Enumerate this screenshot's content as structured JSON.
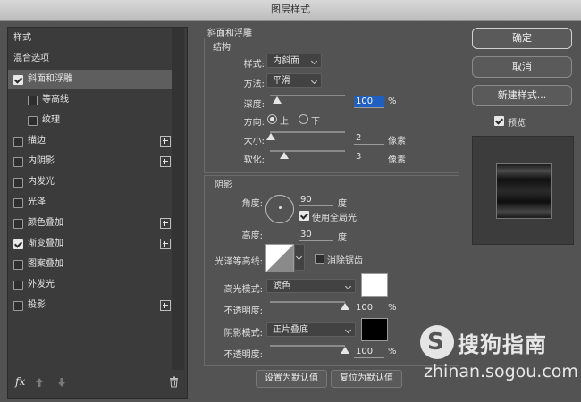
{
  "window": {
    "title": "图层样式"
  },
  "left": {
    "items": [
      {
        "label": "样式"
      },
      {
        "label": "混合选项"
      },
      {
        "label": "斜面和浮雕",
        "checked": true,
        "selected": true
      },
      {
        "label": "等高线",
        "checked": false
      },
      {
        "label": "纹理",
        "checked": false
      },
      {
        "label": "描边",
        "checked": false,
        "plus": true
      },
      {
        "label": "内阴影",
        "checked": false,
        "plus": true
      },
      {
        "label": "内发光",
        "checked": false
      },
      {
        "label": "光泽",
        "checked": false
      },
      {
        "label": "颜色叠加",
        "checked": false,
        "plus": true
      },
      {
        "label": "渐变叠加",
        "checked": true,
        "plus": true
      },
      {
        "label": "图案叠加",
        "checked": false
      },
      {
        "label": "外发光",
        "checked": false
      },
      {
        "label": "投影",
        "checked": false,
        "plus": true
      }
    ],
    "fx_label": "fx"
  },
  "bevel": {
    "section_title": "斜面和浮雕",
    "structure_title": "结构",
    "style_label": "样式:",
    "style_value": "内斜面",
    "technique_label": "方法:",
    "technique_value": "平滑",
    "depth_label": "深度:",
    "depth_value": "100",
    "depth_unit": "%",
    "direction_label": "方向:",
    "dir_up": "上",
    "dir_down": "下",
    "size_label": "大小:",
    "size_value": "2",
    "size_unit": "像素",
    "soften_label": "软化:",
    "soften_value": "3",
    "soften_unit": "像素"
  },
  "shading": {
    "title": "阴影",
    "angle_label": "角度:",
    "angle_value": "90",
    "angle_unit": "度",
    "global_light_label": "使用全局光",
    "altitude_label": "高度:",
    "altitude_value": "30",
    "altitude_unit": "度",
    "gloss_label": "光泽等高线:",
    "antialias_label": "消除锯齿",
    "highlight_mode_label": "高光模式:",
    "highlight_mode_value": "滤色",
    "highlight_opacity_label": "不透明度:",
    "highlight_opacity_value": "100",
    "highlight_opacity_unit": "%",
    "shadow_mode_label": "阴影模式:",
    "shadow_mode_value": "正片叠底",
    "shadow_opacity_label": "不透明度:",
    "shadow_opacity_value": "100",
    "shadow_opacity_unit": "%"
  },
  "buttons": {
    "make_default": "设置为默认值",
    "reset_default": "复位为默认值",
    "ok": "确定",
    "cancel": "取消",
    "new_style": "新建样式...",
    "preview_label": "预览"
  },
  "watermark": {
    "brand": "搜狗指南",
    "url": "zhinan.sogou.com"
  },
  "colors": {
    "highlight": "#ffffff",
    "shadow": "#000000",
    "accent": "#1f5fbf"
  }
}
